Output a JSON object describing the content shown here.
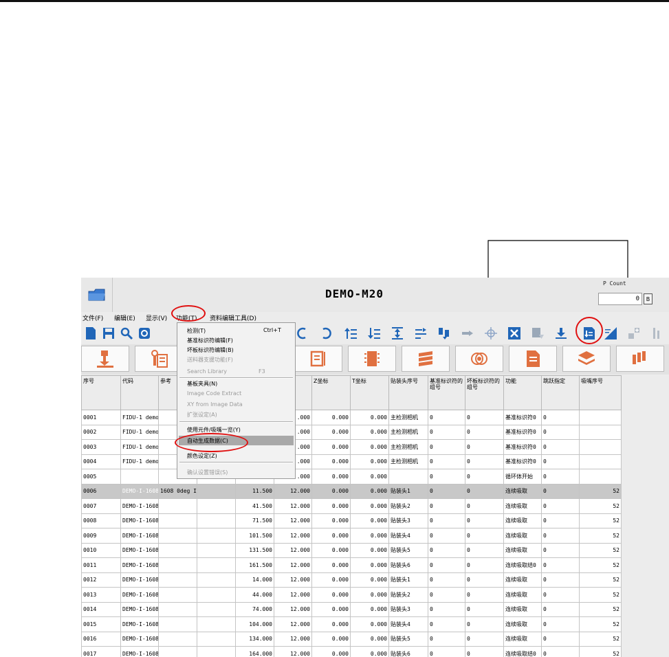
{
  "app": {
    "title": "DEMO-M20",
    "count_label": "P Count",
    "count_value": "0",
    "count_button": "B"
  },
  "menu": {
    "file": "文件(F)",
    "edit": "编辑(E)",
    "view": "显示(V)",
    "function": "功能(T)",
    "data_tools": "资料编辑工具(D)"
  },
  "dropdown": {
    "items": [
      {
        "label": "检测(T)",
        "shortcut": "Ctrl+T"
      },
      {
        "label": "基准标识符编辑(F)"
      },
      {
        "label": "坏板标识符编辑(B)"
      },
      {
        "label": "送料器支援功能(F)",
        "disabled": true
      },
      {
        "label": "Search Library",
        "shortcut": "F3",
        "disabled": true
      },
      {
        "label": "基板夹具(N)"
      },
      {
        "label": "Image Code Extract",
        "disabled": true
      },
      {
        "label": "XY from Image Data",
        "disabled": true
      },
      {
        "label": "扩张设定(A)",
        "disabled": true
      },
      {
        "label": "使用元件/吸嘴一览(Y)"
      },
      {
        "label": "自动生成数据(C)",
        "highlighted": true
      },
      {
        "label": "颜色设定(Z)"
      },
      {
        "label": "确认设置错误(S)",
        "disabled": true
      }
    ]
  },
  "table": {
    "headers": [
      "序号",
      "代码",
      "参考",
      "",
      "",
      "",
      "Z坐标",
      "T坐标",
      "贴装头序号",
      "基准标识符的组号",
      "坏板标识符的组号",
      "功能",
      "跳跃指定",
      "吸嘴序号"
    ],
    "rows": [
      [
        "0001",
        "FIDU-1 demo",
        "",
        "",
        "",
        ".000",
        "0.000",
        "0.000",
        "主检测相机",
        "0",
        "0",
        "基准标识符0",
        "0",
        ""
      ],
      [
        "0002",
        "FIDU-1 demo",
        "",
        "",
        "",
        ".000",
        "0.000",
        "0.000",
        "主检测相机",
        "0",
        "0",
        "基准标识符0",
        "0",
        ""
      ],
      [
        "0003",
        "FIDU-1 demo",
        "",
        "",
        "",
        ".000",
        "0.000",
        "0.000",
        "主检测相机",
        "0",
        "0",
        "基准标识符0",
        "0",
        ""
      ],
      [
        "0004",
        "FIDU-1 demo",
        "",
        "",
        "",
        ".000",
        "0.000",
        "0.000",
        "主检测相机",
        "0",
        "0",
        "基准标识符0",
        "0",
        ""
      ],
      [
        "0005",
        "",
        "",
        "",
        "",
        ".000",
        "0.000",
        "0.000",
        "",
        "0",
        "0",
        "循环体开始",
        "0",
        ""
      ],
      [
        "0006",
        "DEMO-I-1608",
        "1608 0deg I",
        "",
        "11.500",
        "12.000",
        "0.000",
        "0.000",
        "贴装头1",
        "0",
        "0",
        "连续吸取",
        "0",
        "52"
      ],
      [
        "0007",
        "DEMO-I-1608",
        "",
        "",
        "41.500",
        "12.000",
        "0.000",
        "0.000",
        "贴装头2",
        "0",
        "0",
        "连续吸取",
        "0",
        "52"
      ],
      [
        "0008",
        "DEMO-I-1608",
        "",
        "",
        "71.500",
        "12.000",
        "0.000",
        "0.000",
        "贴装头3",
        "0",
        "0",
        "连续吸取",
        "0",
        "52"
      ],
      [
        "0009",
        "DEMO-I-1608",
        "",
        "",
        "101.500",
        "12.000",
        "0.000",
        "0.000",
        "贴装头4",
        "0",
        "0",
        "连续吸取",
        "0",
        "52"
      ],
      [
        "0010",
        "DEMO-I-1608",
        "",
        "",
        "131.500",
        "12.000",
        "0.000",
        "0.000",
        "贴装头5",
        "0",
        "0",
        "连续吸取",
        "0",
        "52"
      ],
      [
        "0011",
        "DEMO-I-1608",
        "",
        "",
        "161.500",
        "12.000",
        "0.000",
        "0.000",
        "贴装头6",
        "0",
        "0",
        "连续吸取结0",
        "0",
        "52"
      ],
      [
        "0012",
        "DEMO-I-1608",
        "",
        "",
        "14.000",
        "12.000",
        "0.000",
        "0.000",
        "贴装头1",
        "0",
        "0",
        "连续吸取",
        "0",
        "52"
      ],
      [
        "0013",
        "DEMO-I-1608",
        "",
        "",
        "44.000",
        "12.000",
        "0.000",
        "0.000",
        "贴装头2",
        "0",
        "0",
        "连续吸取",
        "0",
        "52"
      ],
      [
        "0014",
        "DEMO-I-1608",
        "",
        "",
        "74.000",
        "12.000",
        "0.000",
        "0.000",
        "贴装头3",
        "0",
        "0",
        "连续吸取",
        "0",
        "52"
      ],
      [
        "0015",
        "DEMO-I-1608",
        "",
        "",
        "104.000",
        "12.000",
        "0.000",
        "0.000",
        "贴装头4",
        "0",
        "0",
        "连续吸取",
        "0",
        "52"
      ],
      [
        "0016",
        "DEMO-I-1608",
        "",
        "",
        "134.000",
        "12.000",
        "0.000",
        "0.000",
        "贴装头5",
        "0",
        "0",
        "连续吸取",
        "0",
        "52"
      ],
      [
        "0017",
        "DEMO-I-1608",
        "",
        "",
        "164.000",
        "12.000",
        "0.000",
        "0.000",
        "贴装头6",
        "0",
        "0",
        "连续吸取结0",
        "0",
        "52"
      ]
    ]
  },
  "icons": {
    "toolbar": [
      "new-file-icon",
      "save-icon",
      "search-icon",
      "refresh-icon",
      "undo-icon",
      "redo-icon",
      "indent-up-icon",
      "indent-down-icon",
      "align-icon",
      "sort-icon",
      "move-icon",
      "nozzle-icon",
      "crosshair-icon",
      "delete-icon",
      "copy-down-icon",
      "download-icon",
      "auto-generate-icon",
      "fill-icon",
      "add-icon",
      "more-icon"
    ],
    "bigbar": [
      "head-tool-icon",
      "pcb-icon",
      "board-icon",
      "chip-icon",
      "feeder-icon",
      "reel-icon",
      "document-icon",
      "layers-icon",
      "nozzle-set-icon"
    ]
  },
  "colors": {
    "accent_icon": "#e07040",
    "toolbar_icon": "#2066b8",
    "highlight_ring": "#e01010",
    "selection": "#0000cc"
  }
}
